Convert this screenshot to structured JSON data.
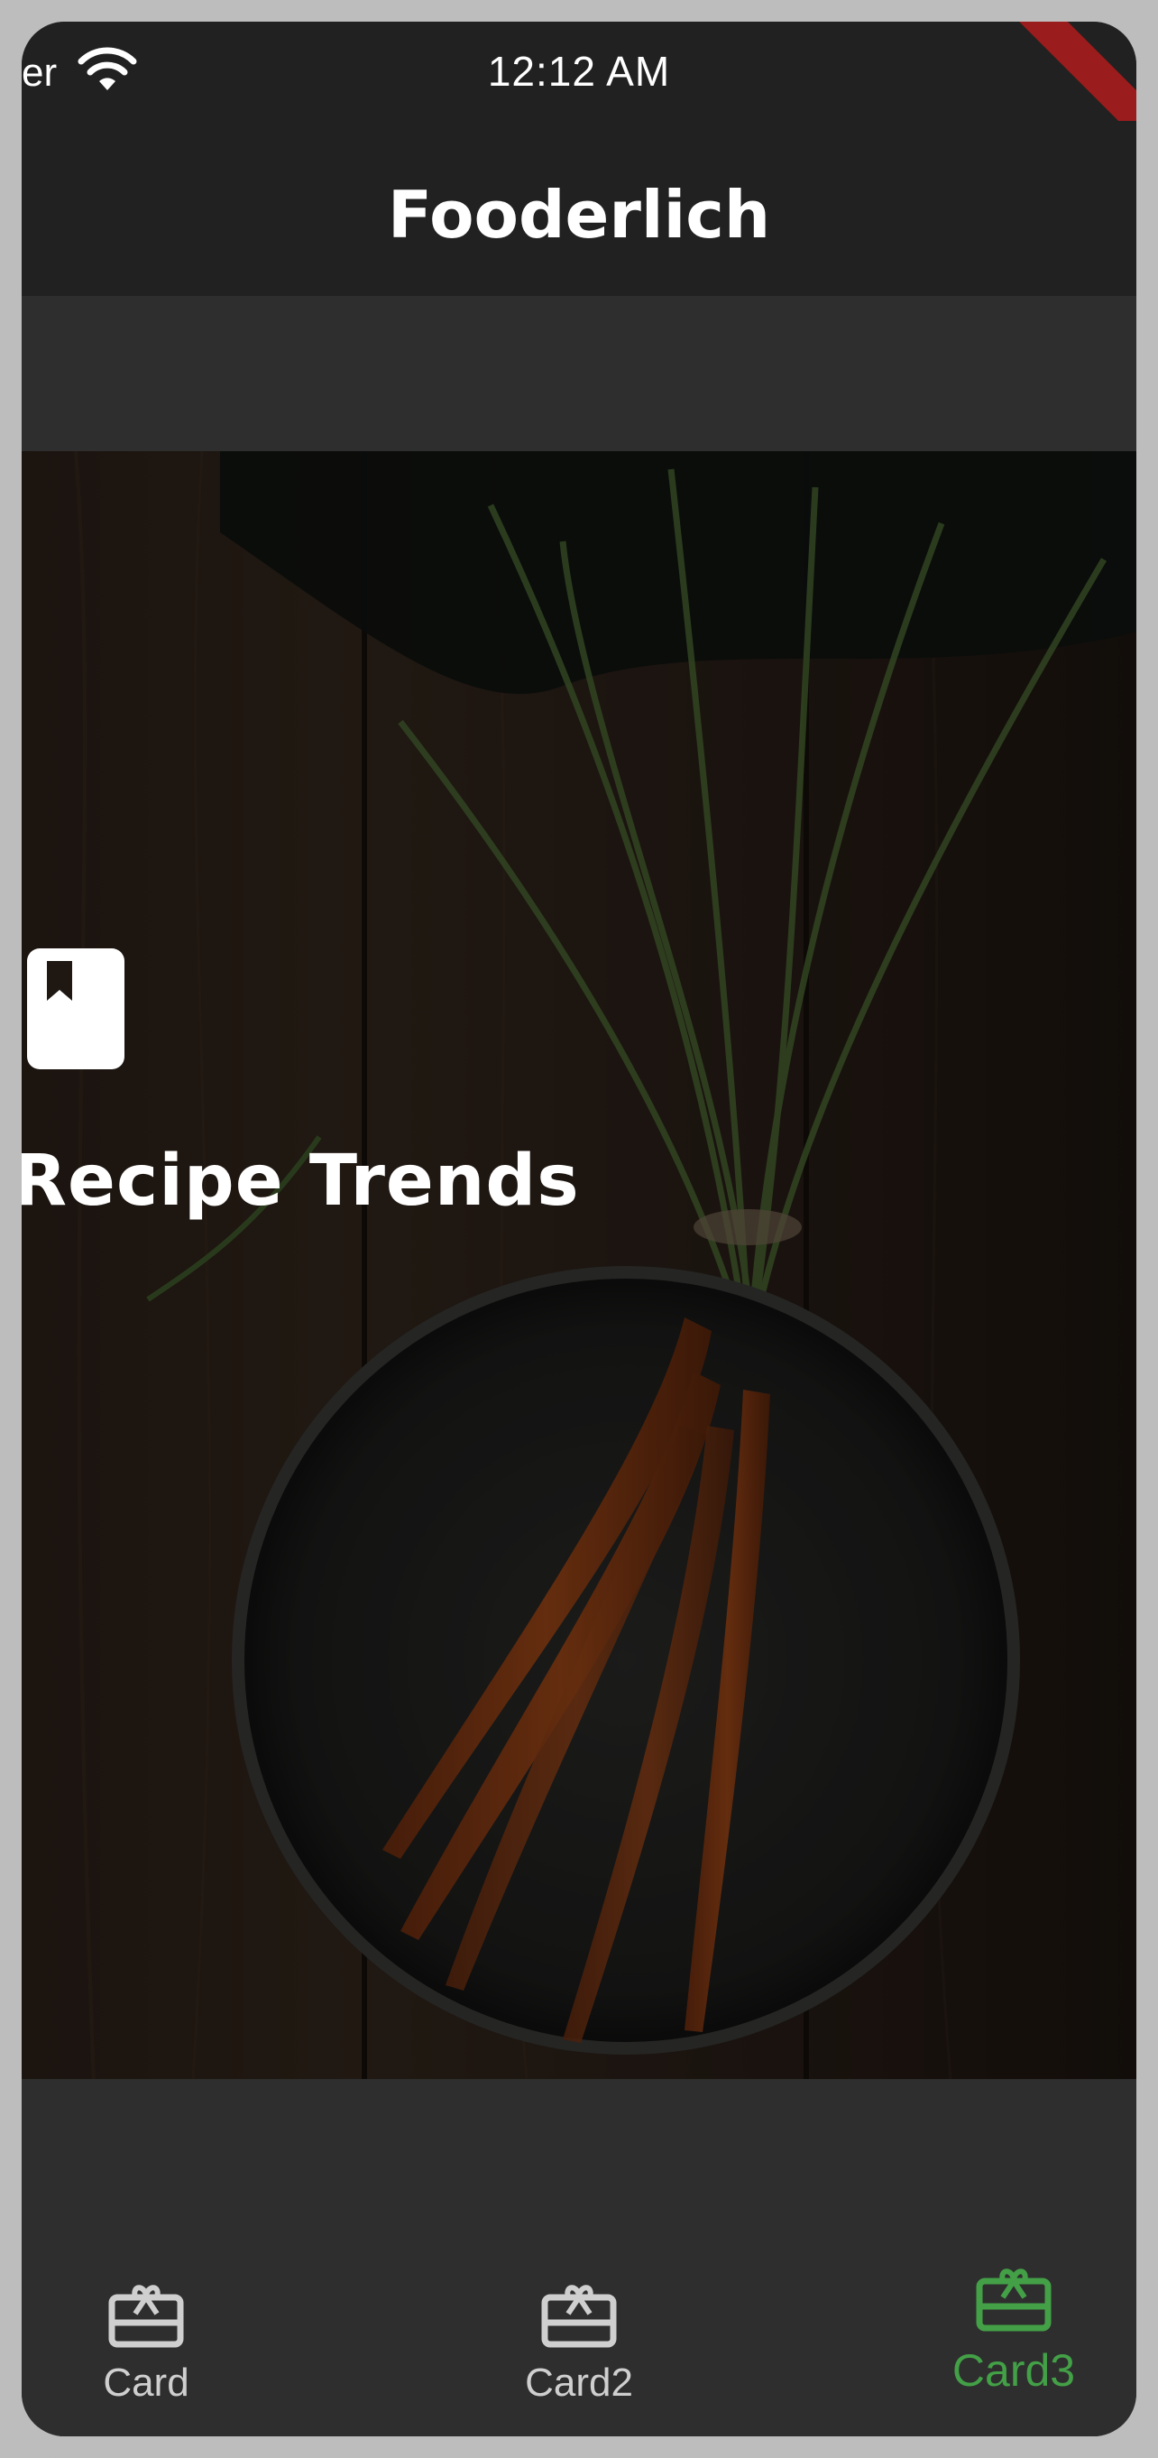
{
  "status_bar": {
    "carrier": "er",
    "time": "12:12 AM"
  },
  "app_bar": {
    "title": "Fooderlich"
  },
  "card": {
    "title": "Recipe Trends",
    "icon": "bookmark-icon"
  },
  "bottom_nav": {
    "items": [
      {
        "label": "Card",
        "icon": "card-giftcard-icon",
        "active": false
      },
      {
        "label": "Card2",
        "icon": "card-giftcard-icon",
        "active": false
      },
      {
        "label": "Card3",
        "icon": "card-giftcard-icon",
        "active": true
      }
    ]
  },
  "colors": {
    "app_bar": "#212121",
    "background": "#2e2e2e",
    "active_tab": "#43a047",
    "inactive_tab": "#cfcfcf"
  }
}
